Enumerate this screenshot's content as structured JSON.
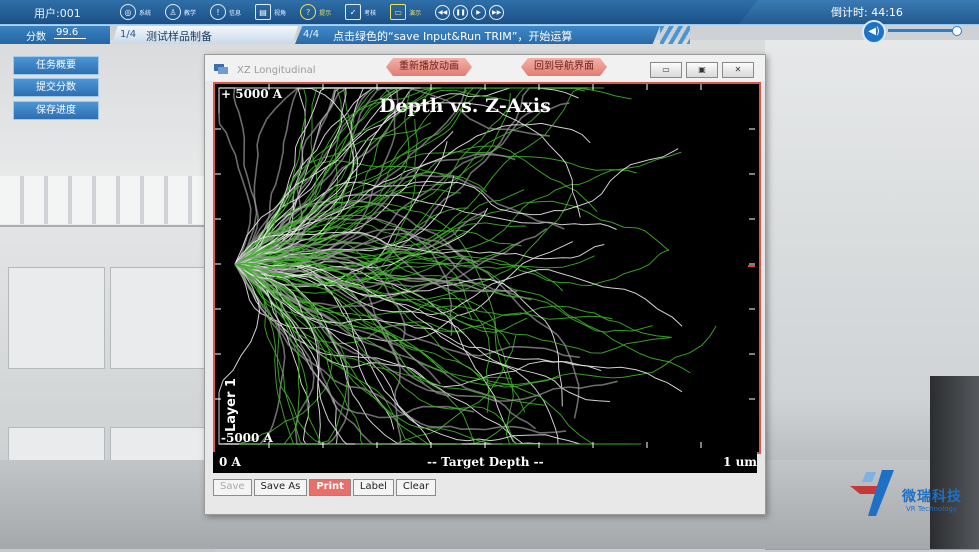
{
  "topbar": {
    "user": "用户:001",
    "menu": [
      {
        "label": "系统",
        "icon": "globe-icon"
      },
      {
        "label": "教学",
        "icon": "teacher-icon"
      },
      {
        "label": "信息",
        "icon": "warning-icon"
      },
      {
        "label": "视角",
        "icon": "picture-icon"
      },
      {
        "label": "提示",
        "icon": "question-icon"
      },
      {
        "label": "考核",
        "icon": "clipboard-icon"
      },
      {
        "label": "演示",
        "icon": "monitor-icon"
      }
    ],
    "timer": "倒计时: 44:16"
  },
  "score": {
    "label": "分数",
    "value": "99.6"
  },
  "steps": [
    {
      "num": "1/4",
      "text": "测试样品制备"
    },
    {
      "num": "4/4",
      "text": "点击绿色的“save Input&Run TRIM”，开始运算"
    }
  ],
  "side_buttons": [
    "任务概要",
    "提交分数",
    "保存进度"
  ],
  "overlay_buttons": {
    "replay": "重新播放动画",
    "back": "回到导航界面"
  },
  "window": {
    "title": "XZ Longitudinal",
    "controls": {
      "minimize": "▭",
      "maximize": "▣",
      "close": "✕"
    }
  },
  "plot": {
    "title": "Depth vs. Z-Axis",
    "y_top": "+ 5000 A",
    "y_bottom": "-5000 A",
    "layer_label": "Layer 1",
    "x_left": "0 A",
    "x_center": "-- Target Depth --",
    "x_right": "1 um"
  },
  "bottom_buttons": [
    {
      "label": "Save",
      "state": "disabled"
    },
    {
      "label": "Save As",
      "state": "normal"
    },
    {
      "label": "Print",
      "state": "highlight"
    },
    {
      "label": "Label",
      "state": "normal"
    },
    {
      "label": "Clear",
      "state": "normal"
    }
  ],
  "logo": {
    "cn": "微瑞科技",
    "en": "VR Technology"
  },
  "colors": {
    "accent": "#2466a3",
    "highlight": "#f2e25c",
    "track_green": "#3fae2a",
    "frame_red": "#d7594b"
  }
}
